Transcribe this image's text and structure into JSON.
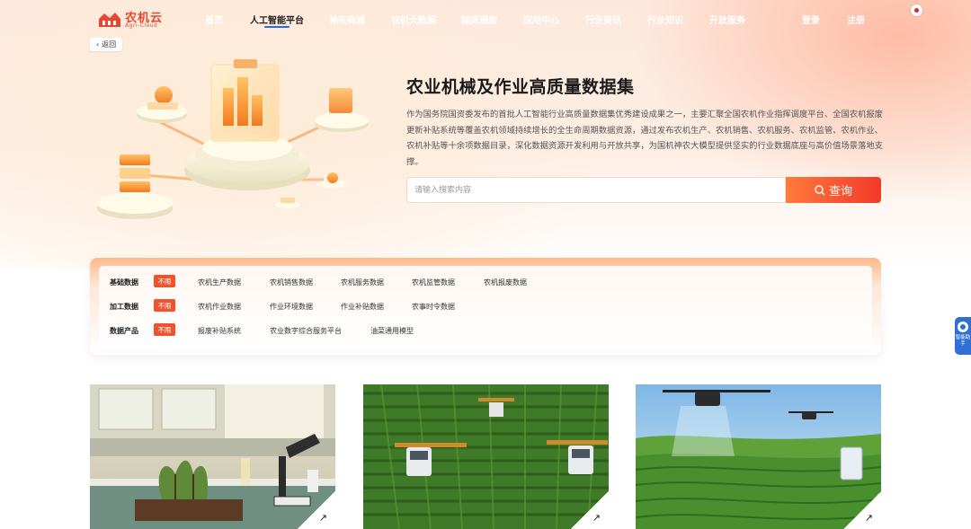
{
  "logo": {
    "name_cn": "农机云",
    "name_en": "Agri-Cloud"
  },
  "nav": {
    "items": [
      {
        "label": "首页"
      },
      {
        "label": "人工智能平台"
      },
      {
        "label": "神农商城"
      },
      {
        "label": "农机大数据"
      },
      {
        "label": "指挥调度"
      },
      {
        "label": "应用中心"
      },
      {
        "label": "行业资讯"
      },
      {
        "label": "行业知识"
      },
      {
        "label": "开放服务"
      }
    ],
    "active": "人工智能平台",
    "login": "登录",
    "register": "注册"
  },
  "back_label": "返回",
  "hero": {
    "title": "农业机械及作业高质量数据集",
    "description": "作为国务院国资委发布的首批人工智能行业高质量数据集优秀建设成果之一，主要汇聚全国农机作业指挥调度平台、全国农机报废更新补贴系统等覆盖农机领域持续增长的全生命周期数据资源，通过发布农机生产、农机销售、农机服务、农机监管、农机作业、农机补贴等十余项数据目录，深化数据资源开发利用与开放共享，为国机神农大模型提供坚实的行业数据底座与高价值场景落地支撑。"
  },
  "search": {
    "placeholder": "请输入搜索内容",
    "button_label": "查询"
  },
  "filters": [
    {
      "label": "基础数据",
      "tag": "不限",
      "options": [
        "农机生产数据",
        "农机销售数据",
        "农机服务数据",
        "农机监管数据",
        "农机报废数据"
      ]
    },
    {
      "label": "加工数据",
      "tag": "不限",
      "options": [
        "农机作业数据",
        "作业环境数据",
        "作业补贴数据",
        "农事时令数据"
      ]
    },
    {
      "label": "数据产品",
      "tag": "不限",
      "options": [
        "报废补贴系统",
        "农业数字综合服务平台",
        "油菜通用模型"
      ]
    }
  ],
  "assistant_label": "智能助手",
  "colors": {
    "accent": "#f0522d",
    "brand_red": "#e8472f",
    "nav_active_underline": "#1e6bf0",
    "assistant": "#2f6fd6"
  }
}
